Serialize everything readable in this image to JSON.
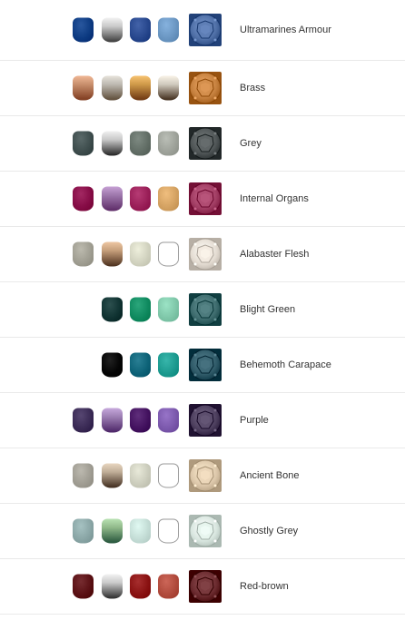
{
  "rows": [
    {
      "label": "Ultramarines Armour",
      "paints": [
        "#0d3b82",
        "gradient:#f2f2f2:#3a3a3a",
        "#27478d",
        "#6a96c2"
      ],
      "swatch": "#4f6fa6",
      "swatch_icon": "armor-plate-swatch-icon"
    },
    {
      "label": "Brass",
      "paints": [
        "gradient:#f0b795:#7e3a1e",
        "gradient:#e6e2da:#5c4a36",
        "gradient:#f7c271:#6b3410",
        "gradient:#f8f2e6:#3e2a18"
      ],
      "swatch": "#c5803e",
      "swatch_icon": "armor-plate-swatch-icon"
    },
    {
      "label": "Grey",
      "paints": [
        "#3e4d4d",
        "gradient:#f0f0f0:#232323",
        "#626e66",
        "#9ea29a"
      ],
      "swatch": "#4f5556",
      "swatch_icon": "armor-plate-swatch-icon"
    },
    {
      "label": "Internal Organs",
      "paints": [
        "#860c46",
        "gradient:#c6a0d4:#5c2a66",
        "#9a1f58",
        "#d4a262"
      ],
      "swatch": "#a13d63",
      "swatch_icon": "armor-plate-swatch-icon"
    },
    {
      "label": "Alabaster Flesh",
      "paints": [
        "#a09e92",
        "gradient:#eec7a3:#4a2e1c",
        "#d2d3c0",
        "empty"
      ],
      "swatch": "#e4dcd2",
      "swatch_icon": "armor-plate-swatch-icon"
    },
    {
      "label": "Blight Green",
      "paints": [
        "none",
        "#103332",
        "#0f8a5f",
        "#7fc7a9"
      ],
      "swatch": "#3e6c6e",
      "swatch_icon": "armor-plate-swatch-icon"
    },
    {
      "label": "Behemoth Carapace",
      "paints": [
        "none",
        "#050505",
        "#0e6378",
        "#1c9a8f"
      ],
      "swatch": "#2f5a68",
      "swatch_icon": "armor-plate-swatch-icon"
    },
    {
      "label": "Purple",
      "paints": [
        "#3a2a55",
        "gradient:#c6a8dc:#4a2366",
        "#43125f",
        "#7b58ac"
      ],
      "swatch": "#4d3f5e",
      "swatch_icon": "armor-plate-swatch-icon"
    },
    {
      "label": "Ancient Bone",
      "paints": [
        "#a09d93",
        "gradient:#e8d6c0:#3e2a1c",
        "#cccdbd",
        "empty"
      ],
      "swatch": "#dcc7aa",
      "swatch_icon": "armor-plate-swatch-icon"
    },
    {
      "label": "Ghostly Grey",
      "paints": [
        "#8aa6a6",
        "gradient:#b9e2b3:#24533a",
        "#c4ddd6",
        "empty"
      ],
      "swatch": "#d8e6df",
      "swatch_icon": "armor-plate-swatch-icon"
    },
    {
      "label": "Red-brown",
      "paints": [
        "#5a1014",
        "gradient:#f2f2f2:#2a2a2a",
        "#8a1212",
        "#b04a3c"
      ],
      "swatch": "#6a2a2e",
      "swatch_icon": "armor-plate-swatch-icon"
    }
  ]
}
